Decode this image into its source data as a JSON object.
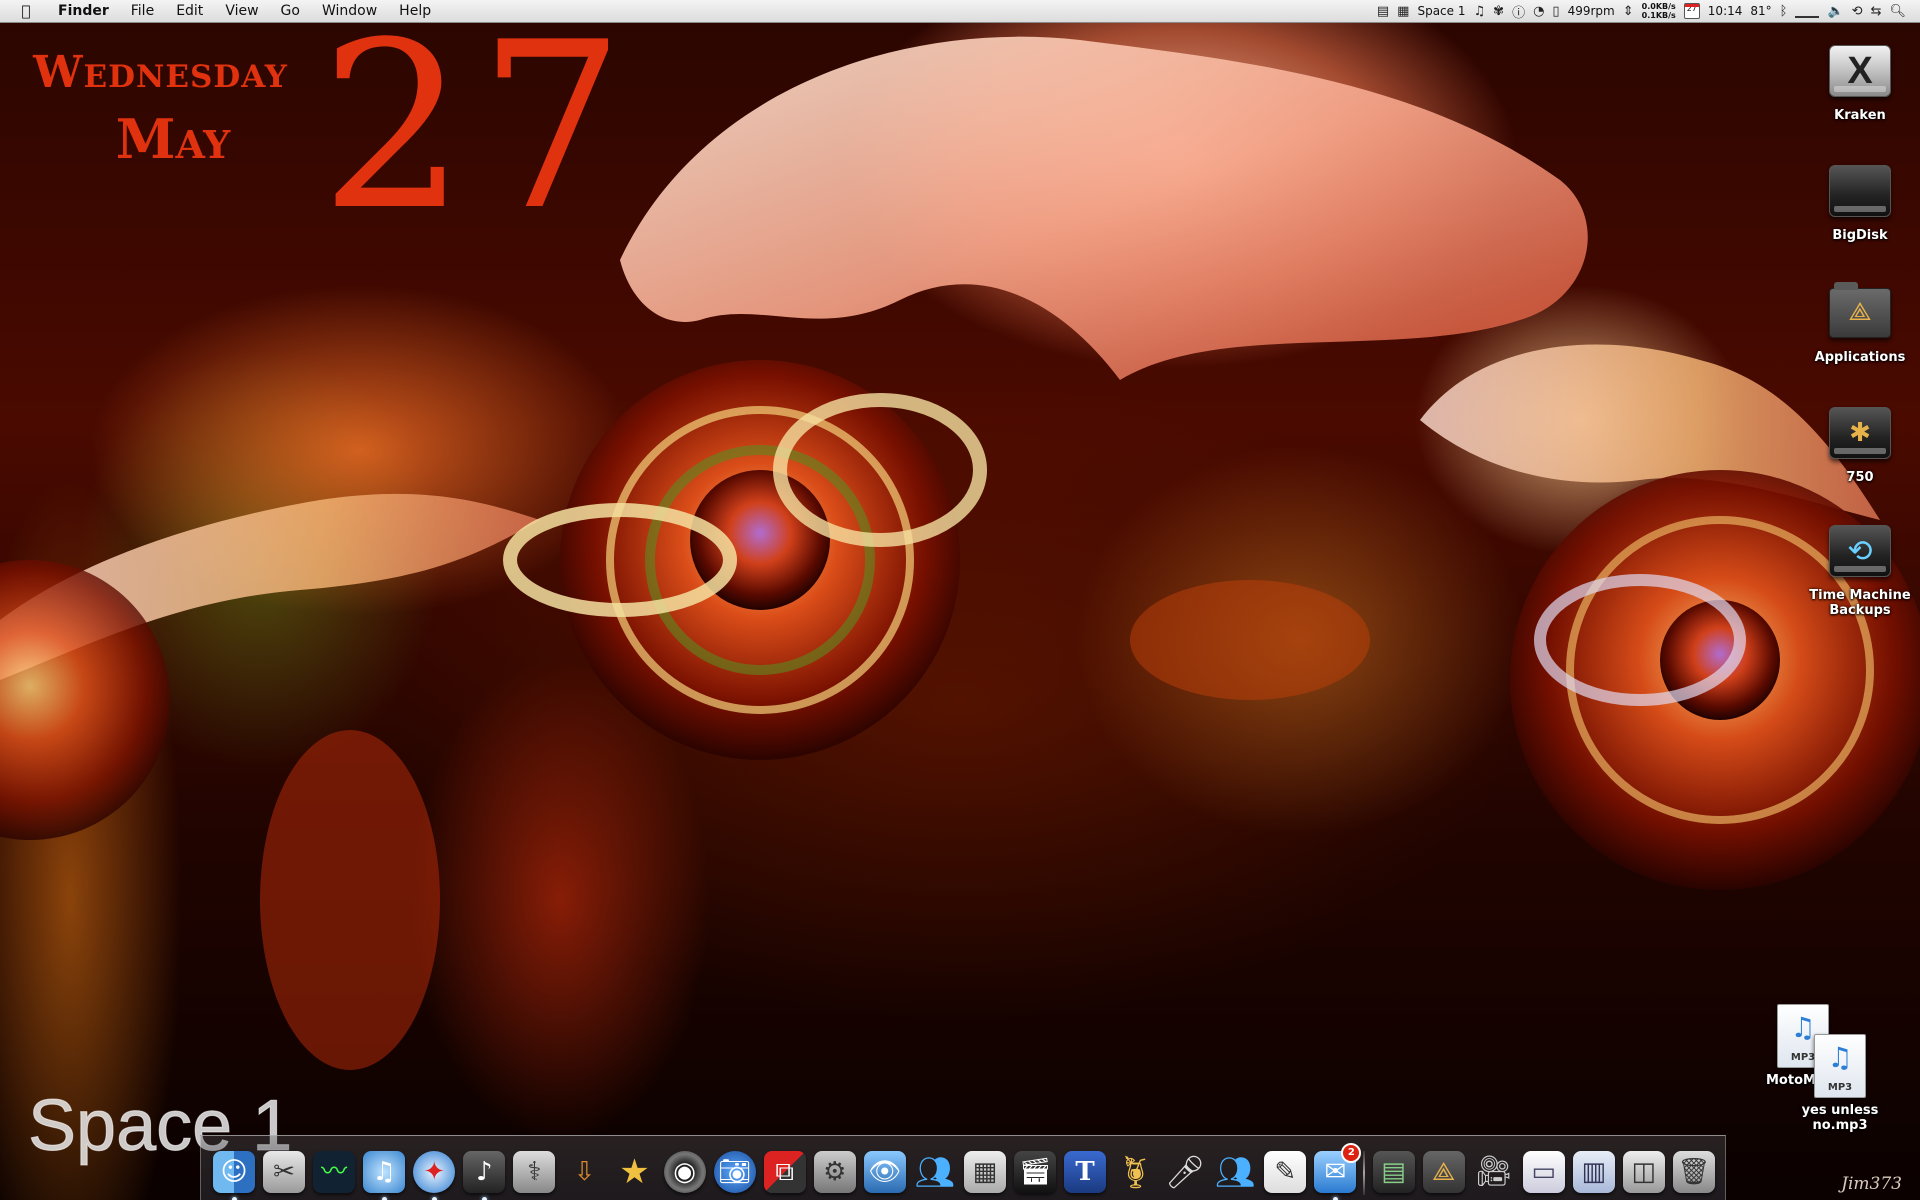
{
  "menubar": {
    "app_name": "Finder",
    "menus": [
      "File",
      "Edit",
      "View",
      "Go",
      "Window",
      "Help"
    ],
    "status": {
      "space_label": "Space 1",
      "fan_speed": "499rpm",
      "net_down": "0.0KB/s",
      "net_up": "0.1KB/s",
      "calendar_day": "27",
      "clock": "10:14",
      "temperature": "81°"
    }
  },
  "date_widget": {
    "weekday": "Wednesday",
    "month": "May",
    "day": "27",
    "color": "#e0320e"
  },
  "space_overlay": "Space 1",
  "desktop_icons": {
    "kraken": "Kraken",
    "bigdisk": "BigDisk",
    "applications": "Applications",
    "fw750": "750",
    "time_machine": "Time Machine Backups",
    "motomoto": "MotoMoto",
    "yes_unless": "yes unless no.mp3",
    "mp3_ext": "MP3"
  },
  "dock": {
    "mail_badge": "2"
  },
  "signature": "Jim373"
}
